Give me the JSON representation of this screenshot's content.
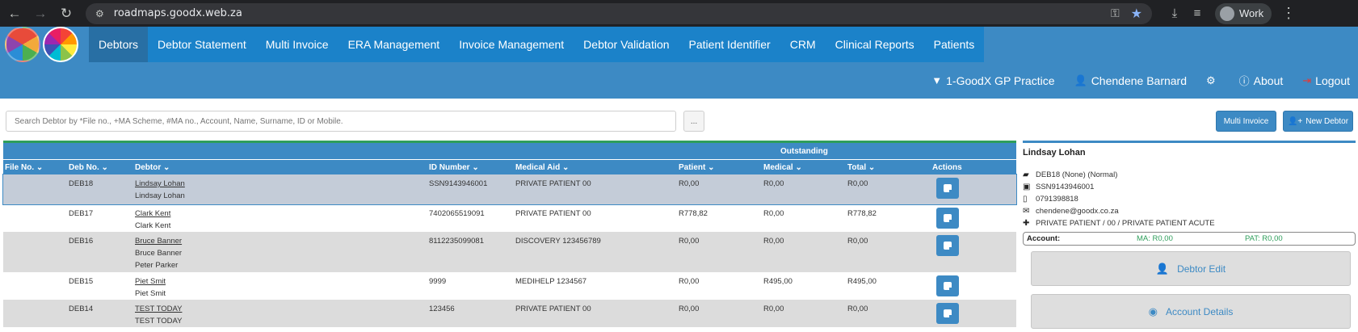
{
  "browser": {
    "url": "roadmaps.goodx.web.za",
    "profile": "Work"
  },
  "nav": {
    "items": [
      "Debtors",
      "Debtor Statement",
      "Multi Invoice",
      "ERA Management",
      "Invoice Management",
      "Debtor Validation",
      "Patient Identifier",
      "CRM",
      "Clinical Reports",
      "Patients"
    ],
    "active": "Debtors"
  },
  "userbar": {
    "practice": "1-GoodX GP Practice",
    "user": "Chendene Barnard",
    "about": "About",
    "logout": "Logout"
  },
  "search": {
    "placeholder": "Search Debtor by *File no., +MA Scheme, #MA no., Account, Name, Surname, ID or Mobile.",
    "dots": "...",
    "multi_invoice": "Multi Invoice",
    "new_debtor": "New Debtor"
  },
  "table": {
    "group_header": "Outstanding",
    "headers": {
      "file_no": "File No.",
      "deb_no": "Deb No.",
      "debtor": "Debtor",
      "id_number": "ID Number",
      "medical_aid": "Medical Aid",
      "patient": "Patient",
      "medical": "Medical",
      "total": "Total",
      "actions": "Actions"
    },
    "rows": [
      {
        "file_no": "",
        "deb_no": "DEB18",
        "debtor": "Lindsay Lohan",
        "patients": [
          "Lindsay Lohan"
        ],
        "id_number": "SSN9143946001",
        "medical_aid": "PRIVATE PATIENT 00",
        "patient": "R0,00",
        "medical": "R0,00",
        "total": "R0,00"
      },
      {
        "file_no": "",
        "deb_no": "DEB17",
        "debtor": "Clark Kent",
        "patients": [
          "Clark Kent"
        ],
        "id_number": "7402065519091",
        "medical_aid": "PRIVATE PATIENT 00",
        "patient": "R778,82",
        "medical": "R0,00",
        "total": "R778,82"
      },
      {
        "file_no": "",
        "deb_no": "DEB16",
        "debtor": "Bruce Banner",
        "patients": [
          "Bruce Banner",
          "Peter Parker"
        ],
        "id_number": "8112235099081",
        "medical_aid": "DISCOVERY 123456789",
        "patient": "R0,00",
        "medical": "R0,00",
        "total": "R0,00"
      },
      {
        "file_no": "",
        "deb_no": "DEB15",
        "debtor": "Piet Smit",
        "patients": [
          "Piet Smit"
        ],
        "id_number": "9999",
        "medical_aid": "MEDIHELP 1234567",
        "patient": "R0,00",
        "medical": "R495,00",
        "total": "R495,00"
      },
      {
        "file_no": "",
        "deb_no": "DEB14",
        "debtor": "TEST TODAY",
        "patients": [
          "TEST TODAY"
        ],
        "id_number": "123456",
        "medical_aid": "PRIVATE PATIENT 00",
        "patient": "R0,00",
        "medical": "R0,00",
        "total": "R0,00"
      }
    ]
  },
  "panel": {
    "name": "Lindsay Lohan",
    "deb": "DEB18 (None) (Normal)",
    "id": "SSN9143946001",
    "phone": "0791398818",
    "email": "chendene@goodx.co.za",
    "scheme": "PRIVATE PATIENT / 00 / PRIVATE PATIENT ACUTE",
    "account_label": "Account:",
    "ma": "MA: R0,00",
    "pat": "PAT: R0,00",
    "debtor_edit": "Debtor Edit",
    "account_details": "Account Details"
  }
}
